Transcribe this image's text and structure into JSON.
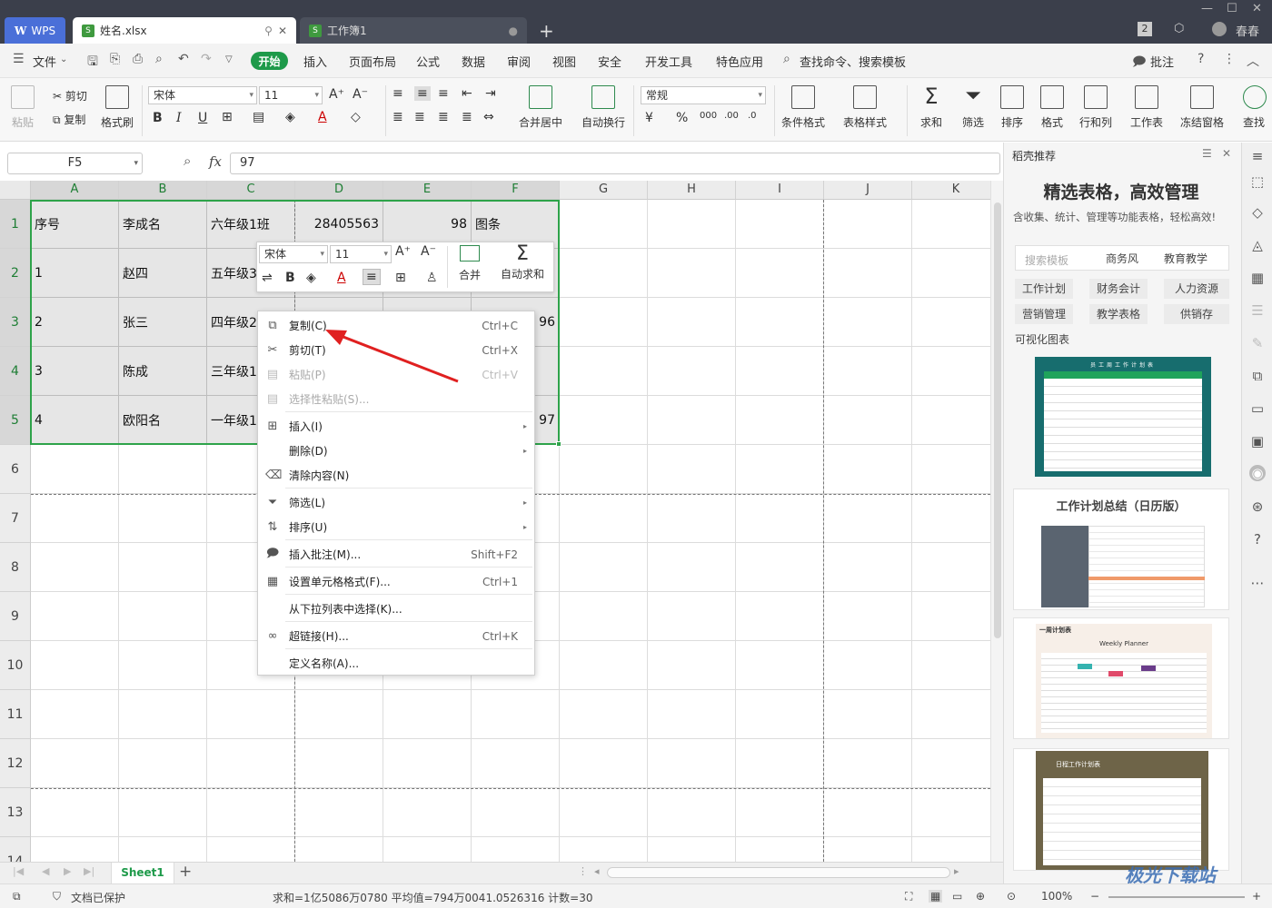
{
  "titlebar": {
    "app_tab": "WPS",
    "doc_tab_active": "姓名.xlsx",
    "doc_tab_inactive": "工作簿1",
    "badge": "2",
    "user": "春春"
  },
  "menu": {
    "file": "文件",
    "start": "开始",
    "items": [
      "插入",
      "页面布局",
      "公式",
      "数据",
      "审阅",
      "视图",
      "安全",
      "开发工具",
      "特色应用"
    ],
    "search": "查找命令、搜索模板",
    "comment": "批注"
  },
  "ribbon": {
    "paste": "粘贴",
    "cut": "剪切",
    "copy": "复制",
    "format_painter": "格式刷",
    "font_name": "宋体",
    "font_size": "11",
    "merge_center": "合并居中",
    "wrap_text": "自动换行",
    "number_format": "常规",
    "conditional_format": "条件格式",
    "table_style": "表格样式",
    "sum": "求和",
    "filter": "筛选",
    "sort": "排序",
    "format": "格式",
    "row_col": "行和列",
    "worksheet": "工作表",
    "freeze": "冻结窗格",
    "find": "查找"
  },
  "formula_bar": {
    "cell_ref": "F5",
    "fx": "fx",
    "value": "97"
  },
  "grid": {
    "columns": [
      "A",
      "B",
      "C",
      "D",
      "E",
      "F",
      "G",
      "H",
      "I",
      "J",
      "K"
    ],
    "rows": [
      "1",
      "2",
      "3",
      "4",
      "5",
      "6",
      "7",
      "8",
      "9",
      "10",
      "11",
      "12",
      "13",
      "14"
    ],
    "cells": {
      "A1": "序号",
      "B1": "李成名",
      "C1": "六年级1班",
      "D1": "28405563",
      "E1": "98",
      "F1": "图条",
      "A2": "1",
      "B2": "赵四",
      "C2": "五年级3",
      "A3": "2",
      "B3": "张三",
      "C3": "四年级2",
      "F3": "96",
      "A4": "3",
      "B4": "陈成",
      "C4": "三年级1",
      "A5": "4",
      "B5": "欧阳名",
      "C5": "一年级1",
      "F5": "97"
    }
  },
  "mini_toolbar": {
    "font_name": "宋体",
    "font_size": "11",
    "merge": "合并",
    "auto_sum": "自动求和"
  },
  "context_menu": [
    {
      "label": "复制(C)",
      "shortcut": "Ctrl+C",
      "icon": "copy-icon",
      "enabled": true
    },
    {
      "label": "剪切(T)",
      "shortcut": "Ctrl+X",
      "icon": "scissors-icon",
      "enabled": true
    },
    {
      "label": "粘贴(P)",
      "shortcut": "Ctrl+V",
      "icon": "paste-icon",
      "enabled": false
    },
    {
      "label": "选择性粘贴(S)...",
      "shortcut": "",
      "icon": "paste-special-icon",
      "enabled": false
    },
    {
      "label": "插入(I)",
      "shortcut": "",
      "icon": "insert-icon",
      "enabled": true,
      "submenu": true
    },
    {
      "label": "删除(D)",
      "shortcut": "",
      "icon": "",
      "enabled": true,
      "submenu": true
    },
    {
      "label": "清除内容(N)",
      "shortcut": "",
      "icon": "eraser-icon",
      "enabled": true
    },
    {
      "label": "筛选(L)",
      "shortcut": "",
      "icon": "filter-icon",
      "enabled": true,
      "submenu": true
    },
    {
      "label": "排序(U)",
      "shortcut": "",
      "icon": "sort-icon",
      "enabled": true,
      "submenu": true
    },
    {
      "label": "插入批注(M)...",
      "shortcut": "Shift+F2",
      "icon": "comment-icon",
      "enabled": true
    },
    {
      "label": "设置单元格格式(F)...",
      "shortcut": "Ctrl+1",
      "icon": "format-cells-icon",
      "enabled": true
    },
    {
      "label": "从下拉列表中选择(K)...",
      "shortcut": "",
      "icon": "",
      "enabled": true
    },
    {
      "label": "超链接(H)...",
      "shortcut": "Ctrl+K",
      "icon": "link-icon",
      "enabled": true
    },
    {
      "label": "定义名称(A)...",
      "shortcut": "",
      "icon": "",
      "enabled": true
    }
  ],
  "sheetbar": {
    "sheet": "Sheet1"
  },
  "statusbar": {
    "protect": "文档已保护",
    "stats": "求和=1亿5086万0780   平均值=794万0041.0526316   计数=30",
    "zoom": "100%"
  },
  "right_panel": {
    "header": "稻壳推荐",
    "title": "精选表格，高效管理",
    "subtitle": "含收集、统计、管理等功能表格，轻松高效!",
    "search_placeholder": "搜索模板",
    "search_tags": [
      "商务风",
      "教育教学"
    ],
    "chips": [
      "工作计划",
      "财务会计",
      "人力资源",
      "营销管理",
      "教学表格",
      "供销存"
    ],
    "section": "可视化图表",
    "templates": [
      "员工周工作计划表",
      "工作计划总结（日历版）",
      "一周计划表",
      "日程工作计划表"
    ],
    "template_en": "Weekly  Planner"
  },
  "watermark": "极光下载站",
  "colors": {
    "accent_green": "#1e9a4a",
    "selection_border": "#2ea34a",
    "arrow_red": "#e02020"
  }
}
